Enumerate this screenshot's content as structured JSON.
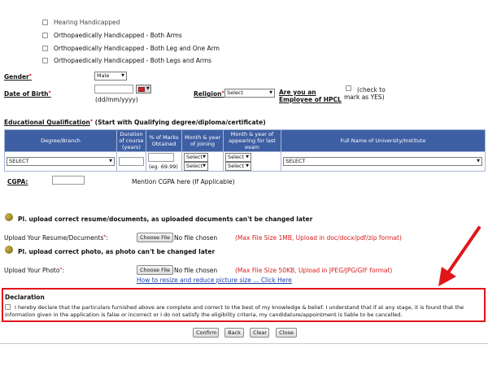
{
  "disability_options": [
    "Hearing Handicapped",
    "Orthopaedically Handicapped - Both Arms",
    "Orthopaedically Handicapped - Both Leg and One Arm",
    "Orthopaedically Handicapped - Both Legs and Arms"
  ],
  "gender": {
    "label": "Gender",
    "required_mark": "*",
    "value": "Male"
  },
  "dob": {
    "label": "Date of Birth",
    "required_mark": "*",
    "format_hint": "(dd/mm/yyyy)"
  },
  "religion": {
    "label": "Religion",
    "required_mark": "*",
    "value": "Select"
  },
  "employee": {
    "label": "Are you an Employee of HPCL",
    "hint": "(check to mark as YES)"
  },
  "education": {
    "heading": "Educational Qualification",
    "required_mark": "*",
    "heading_note": "(Start with Qualifying degree/diploma/certificate)",
    "columns": [
      "Degree/Branch",
      "Duration of course (years)",
      "% of Marks Obtained",
      "Month & year of joining",
      "Month & year of appearing for last exam",
      "Full Name of University/Institute"
    ],
    "row": {
      "degree": "SELECT",
      "marks_hint": "(eg. 69.99)",
      "join_month": "Select",
      "join_year": "Select",
      "exam_month": "Select",
      "exam_year": "Select",
      "university": "SELECT"
    }
  },
  "cgpa": {
    "label": "CGPA:",
    "hint": "Mention CGPA here (If Applicable)"
  },
  "resume": {
    "notice": "Pl. upload correct resume/documents, as uploaded documents can't be changed later",
    "label": "Upload Your Resume/Documents",
    "required_mark": "*",
    "button": "Choose File",
    "status": "No file chosen",
    "limits": "(Max File Size 1MB, Upload in doc/docx/pdf/zip format)"
  },
  "photo": {
    "notice": "Pl. upload correct photo, as photo can't be changed later",
    "label": "Upload Your Photo",
    "required_mark": "*",
    "button": "Choose File",
    "status": "No file chosen",
    "limits": "(Max File Size 50KB, Upload in JPEG/JPG/GIF format)",
    "help_link": "How to resize and reduce picture size ... Click Here"
  },
  "declaration": {
    "title": "Declaration",
    "text_line1": "I hereby declare that the particulars furnished above are complete and correct to the best of my knowledge & belief. I understand that if at any stage, it is found that the",
    "text_line2": "information given in the application is false or incorrect or I do not satisfy the eligibility criteria, my candidature/appointment is liable to be cancelled."
  },
  "actions": {
    "confirm": "Confirm",
    "back": "Back",
    "clear": "Clear",
    "close": "Close"
  },
  "colors": {
    "table_header": "#3e5fa3",
    "highlight": "#e0161b",
    "limits_text": "#d81c1c",
    "link": "#1a3fb0"
  }
}
